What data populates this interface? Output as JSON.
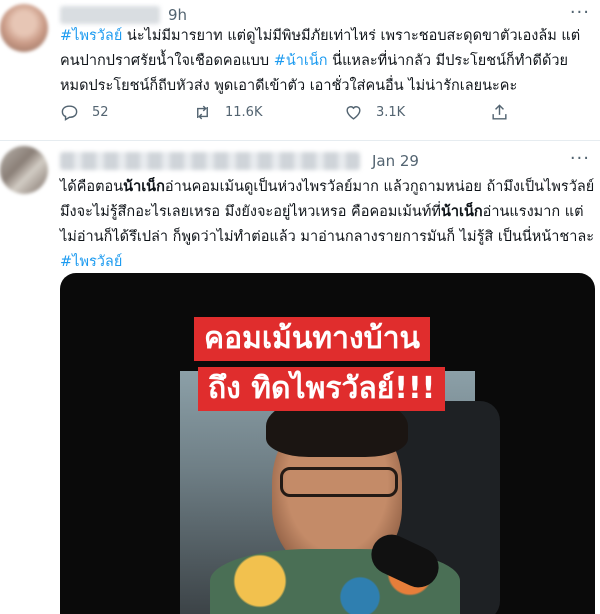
{
  "tweets": [
    {
      "time": "9h",
      "more_label": "···",
      "text_parts": {
        "hashtag1": "#ไพรวัลย์",
        "seg1": " น่ะไม่มีมารยาท แต่ดูไม่มีพิษมีภัยเท่าไหร่ เพราะชอบสะดุดขาตัวเองล้ม แต่คนปากปราศรัยน้ำใจเชือดคอแบบ ",
        "hashtag2": "#น้าเน็ก",
        "seg2": " นี่แหละที่น่ากลัว มีประโยชน์ก็ทำดีด้วย หมดประโยชน์ก็ถีบหัวส่ง พูดเอาดีเข้าตัว เอาชั่วใส่คนอื่น ไม่น่ารักเลยนะคะ"
      },
      "actions": {
        "reply_count": "52",
        "retweet_count": "11.6K",
        "like_count": "3.1K",
        "reply_icon": "reply-icon",
        "retweet_icon": "retweet-icon",
        "like_icon": "heart-icon",
        "share_icon": "share-icon"
      }
    },
    {
      "time": "Jan 29",
      "more_label": "···",
      "text_parts": {
        "seg1": "ได้คือตอน",
        "bold1": "น้าเน็ก",
        "seg2": "อ่านคอมเม้นดูเป็นห่วงไพรวัลย์มาก แล้วกูถามหน่อย ถ้ามึงเป็นไพรวัลย์มึงจะไม่รู้สึกอะไรเลยเหรอ มึงยังจะอยู่ไหวเหรอ คือคอมเม้นท์ที่",
        "bold2": "น้าเน็ก",
        "seg3": "อ่านแรงมาก แต่ไม่อ่านก็ได้รึเปล่า ก็พูดว่าไม่ทำต่อแล้ว มาอ่านกลางรายการมันก็ ไม่รู้สิ เป็นนี่หน้าชาละ ",
        "hashtag": "#ไพรวัลย์"
      },
      "media": {
        "overlay_line1": "คอมเม้นทางบ้าน",
        "overlay_line2": "ถึง ทิดไพรวัลย์!!!"
      }
    }
  ]
}
